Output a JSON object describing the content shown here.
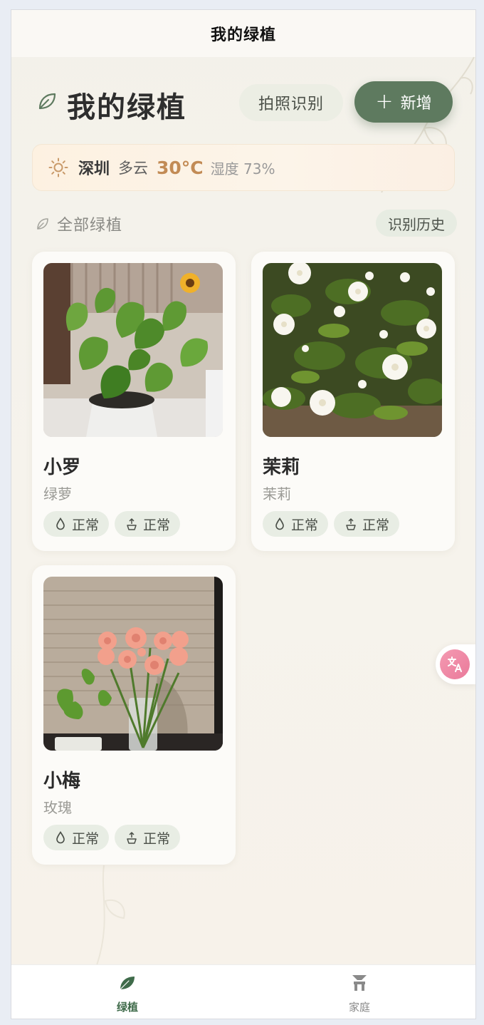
{
  "navbar": {
    "title": "我的绿植"
  },
  "header": {
    "title": "我的绿植",
    "photo_button": "拍照识别",
    "add_button": "新增",
    "icon": "leaf-icon"
  },
  "weather": {
    "city": "深圳",
    "condition": "多云",
    "temperature": "30°C",
    "humidity": "湿度 73%",
    "icon": "sun-icon"
  },
  "section": {
    "title": "全部绿植",
    "history_button": "识别历史"
  },
  "plants": [
    {
      "name": "小罗",
      "species": "绿萝",
      "water_status": "正常",
      "fertilize_status": "正常",
      "photo": "pothos-photo"
    },
    {
      "name": "茉莉",
      "species": "茉莉",
      "water_status": "正常",
      "fertilize_status": "正常",
      "photo": "jasmine-photo"
    },
    {
      "name": "小梅",
      "species": "玫瑰",
      "water_status": "正常",
      "fertilize_status": "正常",
      "photo": "rose-photo"
    }
  ],
  "tabbar": {
    "tabs": [
      {
        "label": "绿植",
        "icon": "leaf-tab-icon",
        "active": true
      },
      {
        "label": "家庭",
        "icon": "home-tab-icon",
        "active": false
      }
    ]
  },
  "colors": {
    "accent": "#5e7a5f",
    "temperature": "#c28b55",
    "active_tab": "#3f6b4a",
    "translate_button": "#ea7a9a"
  }
}
